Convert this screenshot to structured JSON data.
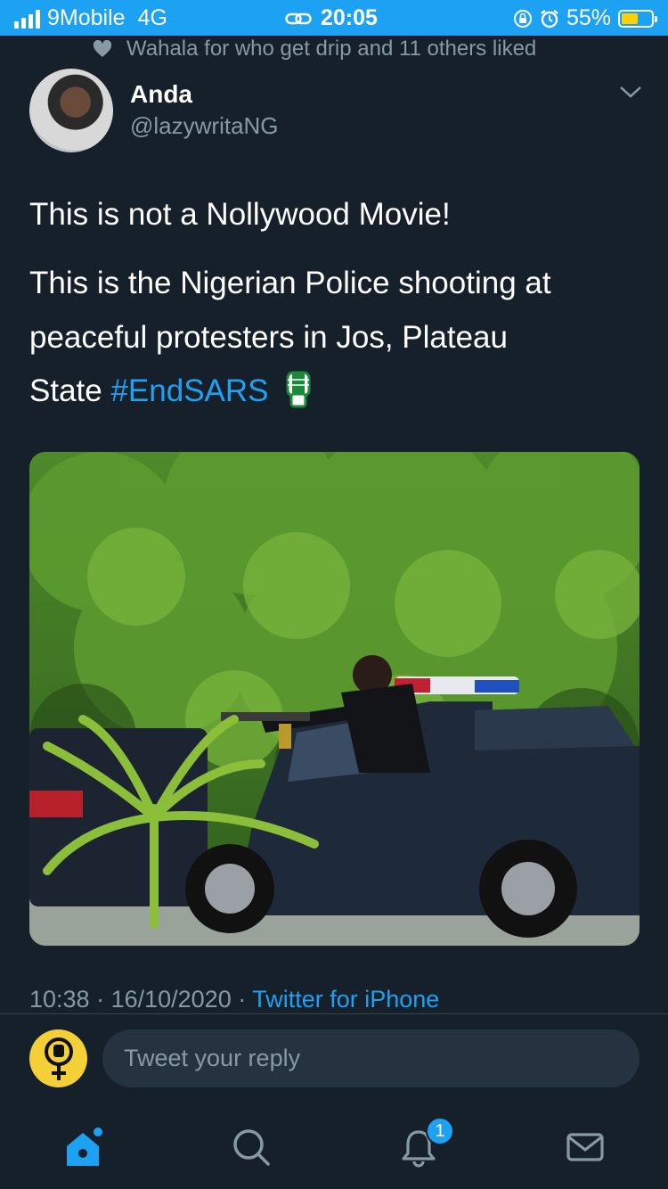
{
  "status": {
    "carrier": "9Mobile",
    "network": "4G",
    "time": "20:05",
    "battery": "55%",
    "battery_level": 0.55
  },
  "context": {
    "liked_text": "Wahala for who get drip and 11 others liked"
  },
  "author": {
    "name": "Anda",
    "handle": "@lazywritaNG"
  },
  "tweet": {
    "line1": "This is not a Nollywood Movie!",
    "line2": "This is the Nigerian Police shooting at",
    "line3": "peaceful protesters in Jos, Plateau",
    "line4_prefix": "State ",
    "hashtag": "#EndSARS"
  },
  "meta": {
    "time": "10:38",
    "sep1": " · ",
    "date": "16/10/2020",
    "sep2": " · ",
    "source": "Twitter for iPhone"
  },
  "reply": {
    "placeholder": "Tweet your reply"
  },
  "tabbar": {
    "notification_count": "1"
  },
  "colors": {
    "accent": "#1da1f2",
    "background": "#15202b",
    "muted": "#8899a6"
  }
}
